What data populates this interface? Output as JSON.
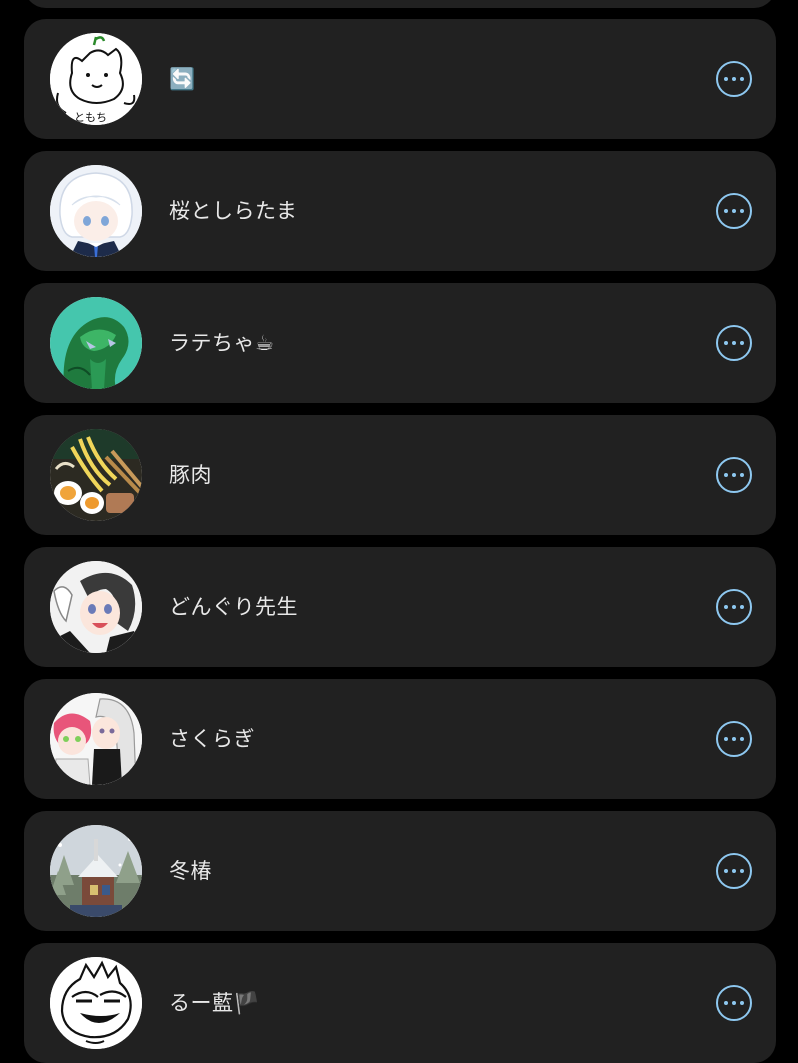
{
  "colors": {
    "background": "#000000",
    "card": "#212121",
    "text": "#e8e8e8",
    "accent": "#8ec8f0"
  },
  "users": [
    {
      "name": "🔄",
      "avatar_icon": "sketch-cat-avatar-icon"
    },
    {
      "name": "桜としらたま",
      "avatar_icon": "anime-white-hair-avatar-icon"
    },
    {
      "name": "ラテちゃ☕",
      "avatar_icon": "green-creature-avatar-icon"
    },
    {
      "name": "豚肉",
      "avatar_icon": "ramen-bowl-avatar-icon"
    },
    {
      "name": "どんぐり先生",
      "avatar_icon": "anime-grey-hair-avatar-icon"
    },
    {
      "name": "さくらぎ",
      "avatar_icon": "anime-pink-hair-avatar-icon"
    },
    {
      "name": "冬椿",
      "avatar_icon": "snowy-house-avatar-icon"
    },
    {
      "name": "るー藍🏴",
      "avatar_icon": "sketch-face-avatar-icon"
    }
  ],
  "more_button_icon": "more-options-icon"
}
